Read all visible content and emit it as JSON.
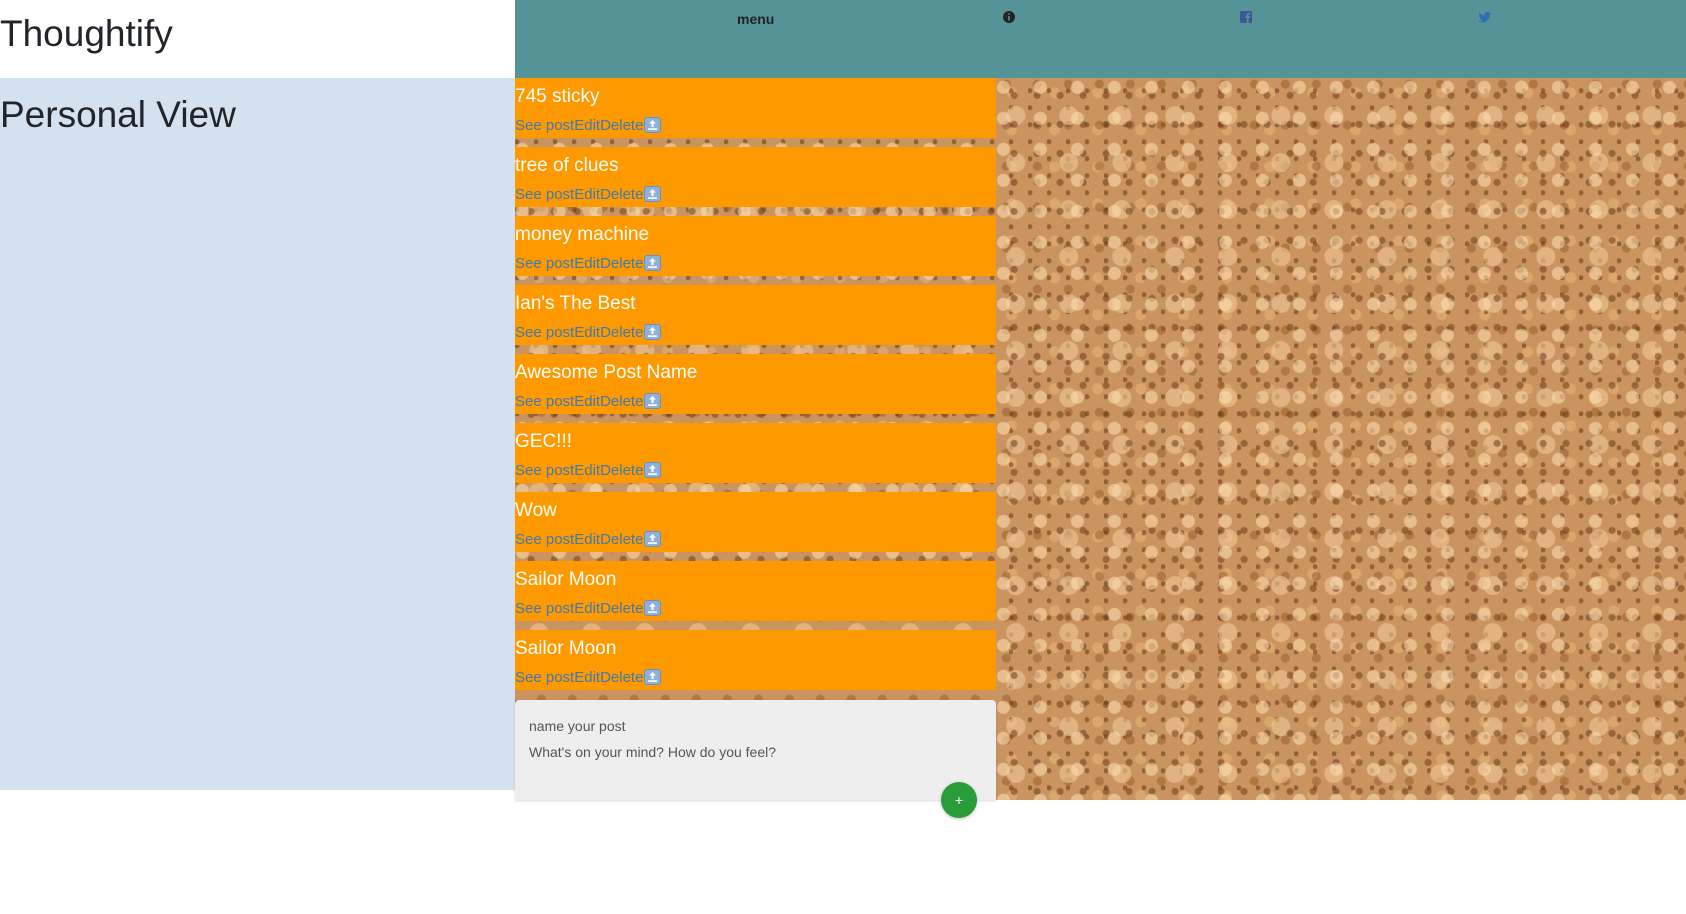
{
  "app": {
    "brand": "Thoughtify"
  },
  "sidebar": {
    "title": "Personal View"
  },
  "topbar": {
    "menu_label": "menu",
    "icons": [
      "info-icon",
      "facebook-icon",
      "twitter-icon"
    ]
  },
  "posts": [
    {
      "title": "745 sticky",
      "see_label": "See post",
      "edit_label": "Edit",
      "delete_label": "Delete"
    },
    {
      "title": "tree of clues",
      "see_label": "See post",
      "edit_label": "Edit",
      "delete_label": "Delete"
    },
    {
      "title": "money machine",
      "see_label": "See post",
      "edit_label": "Edit",
      "delete_label": "Delete"
    },
    {
      "title": "Ian's The Best",
      "see_label": "See post",
      "edit_label": "Edit",
      "delete_label": "Delete"
    },
    {
      "title": "Awesome Post Name",
      "see_label": "See post",
      "edit_label": "Edit",
      "delete_label": "Delete"
    },
    {
      "title": "GEC!!!",
      "see_label": "See post",
      "edit_label": "Edit",
      "delete_label": "Delete"
    },
    {
      "title": "Wow",
      "see_label": "See post",
      "edit_label": "Edit",
      "delete_label": "Delete"
    },
    {
      "title": "Sailor Moon",
      "see_label": "See post",
      "edit_label": "Edit",
      "delete_label": "Delete"
    },
    {
      "title": "Sailor Moon",
      "see_label": "See post",
      "edit_label": "Edit",
      "delete_label": "Delete"
    }
  ],
  "composer": {
    "name_placeholder": "name your post",
    "body_placeholder": "What's on your mind? How do you feel?",
    "add_label": "+"
  },
  "colors": {
    "topbar": "#559496",
    "sidebar": "#d4e2ef",
    "sticky": "#ff9900",
    "link": "#3c7bb4",
    "add_button": "#2a9d3b"
  }
}
